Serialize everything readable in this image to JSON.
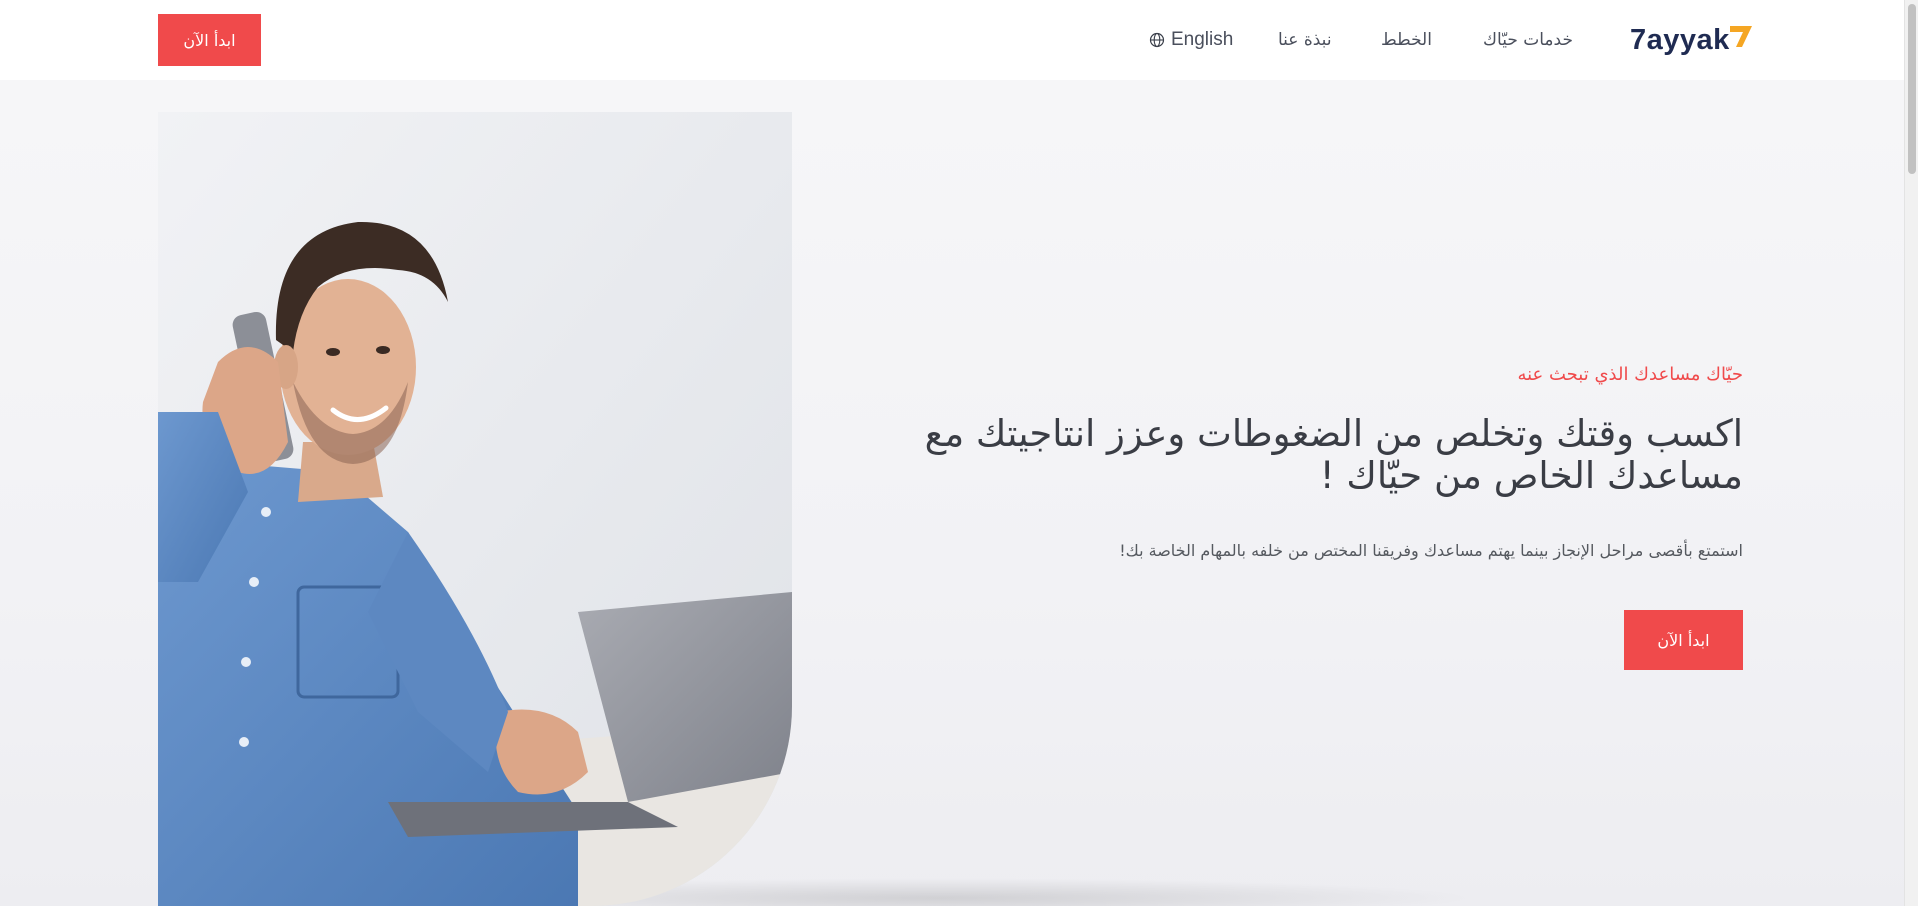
{
  "header": {
    "cta_label": "ابدأ الآن",
    "nav": {
      "language": "English",
      "about": "نبذة عنا",
      "plans": "الخطط",
      "services": "خدمات حيّاك"
    },
    "logo_text": "7ayyak"
  },
  "hero": {
    "eyebrow": "حيّاك مساعدك الذي تبحث عنه",
    "headline_line1": "اكسب وقتك وتخلص من الضغوطات وعزز انتاجيتك مع",
    "headline_line2": "مساعدك الخاص من حيّاك !",
    "subtext": "استمتع بأقصى مراحل الإنجاز بينما يهتم مساعدك وفريقنا المختص من خلفه بالمهام الخاصة بك!",
    "cta_label": "ابدأ الآن"
  },
  "colors": {
    "accent": "#f04a4b",
    "brand_navy": "#1f2b52",
    "brand_orange": "#f5a623"
  },
  "icons": {
    "language": "globe-icon",
    "hero_image": "man-on-phone-with-laptop-photo"
  }
}
